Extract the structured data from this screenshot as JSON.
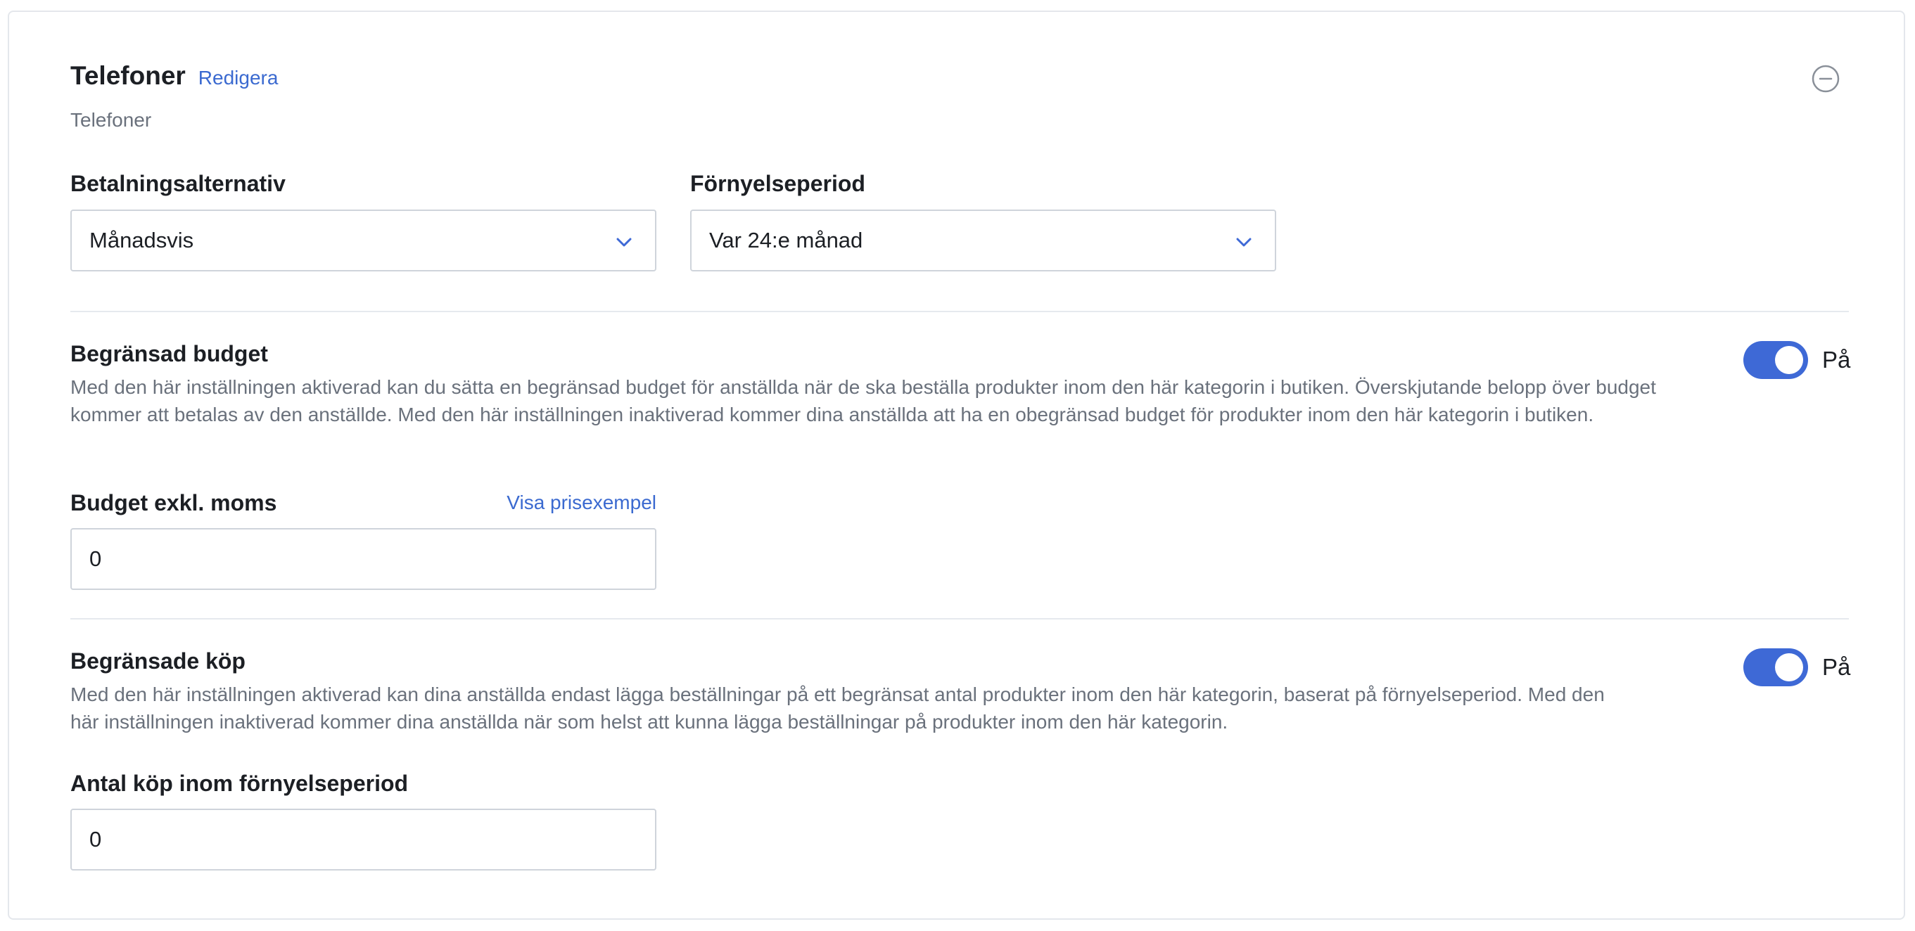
{
  "header": {
    "title": "Telefoner",
    "edit_label": "Redigera",
    "subtitle": "Telefoner",
    "collapse_icon": "minus-circle-icon"
  },
  "payment": {
    "label": "Betalningsalternativ",
    "value": "Månadsvis"
  },
  "renewal": {
    "label": "Förnyelseperiod",
    "value": "Var 24:e månad"
  },
  "budget_section": {
    "title": "Begränsad budget",
    "description": "Med den här inställningen aktiverad kan du sätta en begränsad budget för anställda när de ska beställa produkter inom den här kategorin i butiken. Överskjutande belopp över budget kommer att betalas av den anställde. Med den här inställningen inaktiverad kommer dina anställda att ha en obegränsad budget för produkter inom den här kategorin i butiken.",
    "toggle_on": true,
    "toggle_label": "På",
    "field_label": "Budget exkl. moms",
    "price_example_link": "Visa prisexempel",
    "field_value": "0"
  },
  "purchase_section": {
    "title": "Begränsade köp",
    "description": "Med den här inställningen aktiverad kan dina anställda endast lägga beställningar på ett begränsat antal produkter inom den här kategorin, baserat på förnyelseperiod. Med den här inställningen inaktiverad kommer dina anställda när som helst att kunna lägga beställningar på produkter inom den här kategorin.",
    "toggle_on": true,
    "toggle_label": "På",
    "field_label": "Antal köp inom förnyelseperiod",
    "field_value": "0"
  },
  "colors": {
    "accent": "#3e69d6",
    "link": "#3b6ad0",
    "muted_text": "#6a717c",
    "border": "#cfd4db"
  }
}
